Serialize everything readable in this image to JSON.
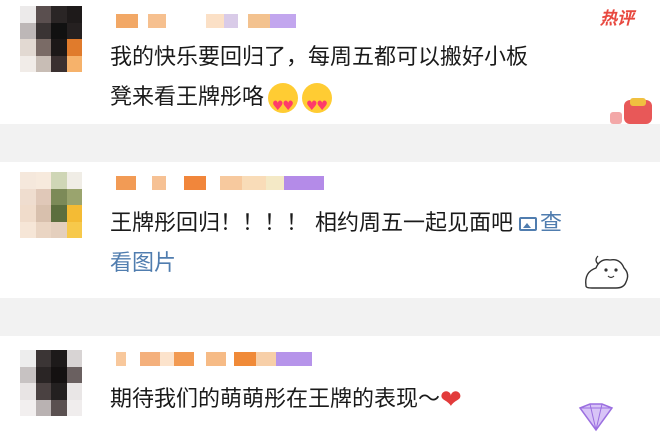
{
  "hot_label": "热评",
  "comments": [
    {
      "text_line1": "我的快乐要回归了，每周五都可以搬好小板",
      "text_line2": "凳来看王牌彤咯",
      "emoji_icon": "heart-eyes-emoji"
    },
    {
      "text": "王牌彤回归！！！！ 相约周五一起见面吧",
      "link_text_line1": "查",
      "link_text_line2": "看图片",
      "link_icon": "picture-icon"
    },
    {
      "text": "期待我们的萌萌彤在王牌的表现～",
      "emoji_icon": "red-heart-emoji",
      "badge_icon": "diamond-badge-icon"
    }
  ],
  "colors": {
    "hot_label": "#e8483f",
    "link": "#507daf",
    "username_orange": "#f5a15a",
    "username_purple": "#b592e8"
  }
}
